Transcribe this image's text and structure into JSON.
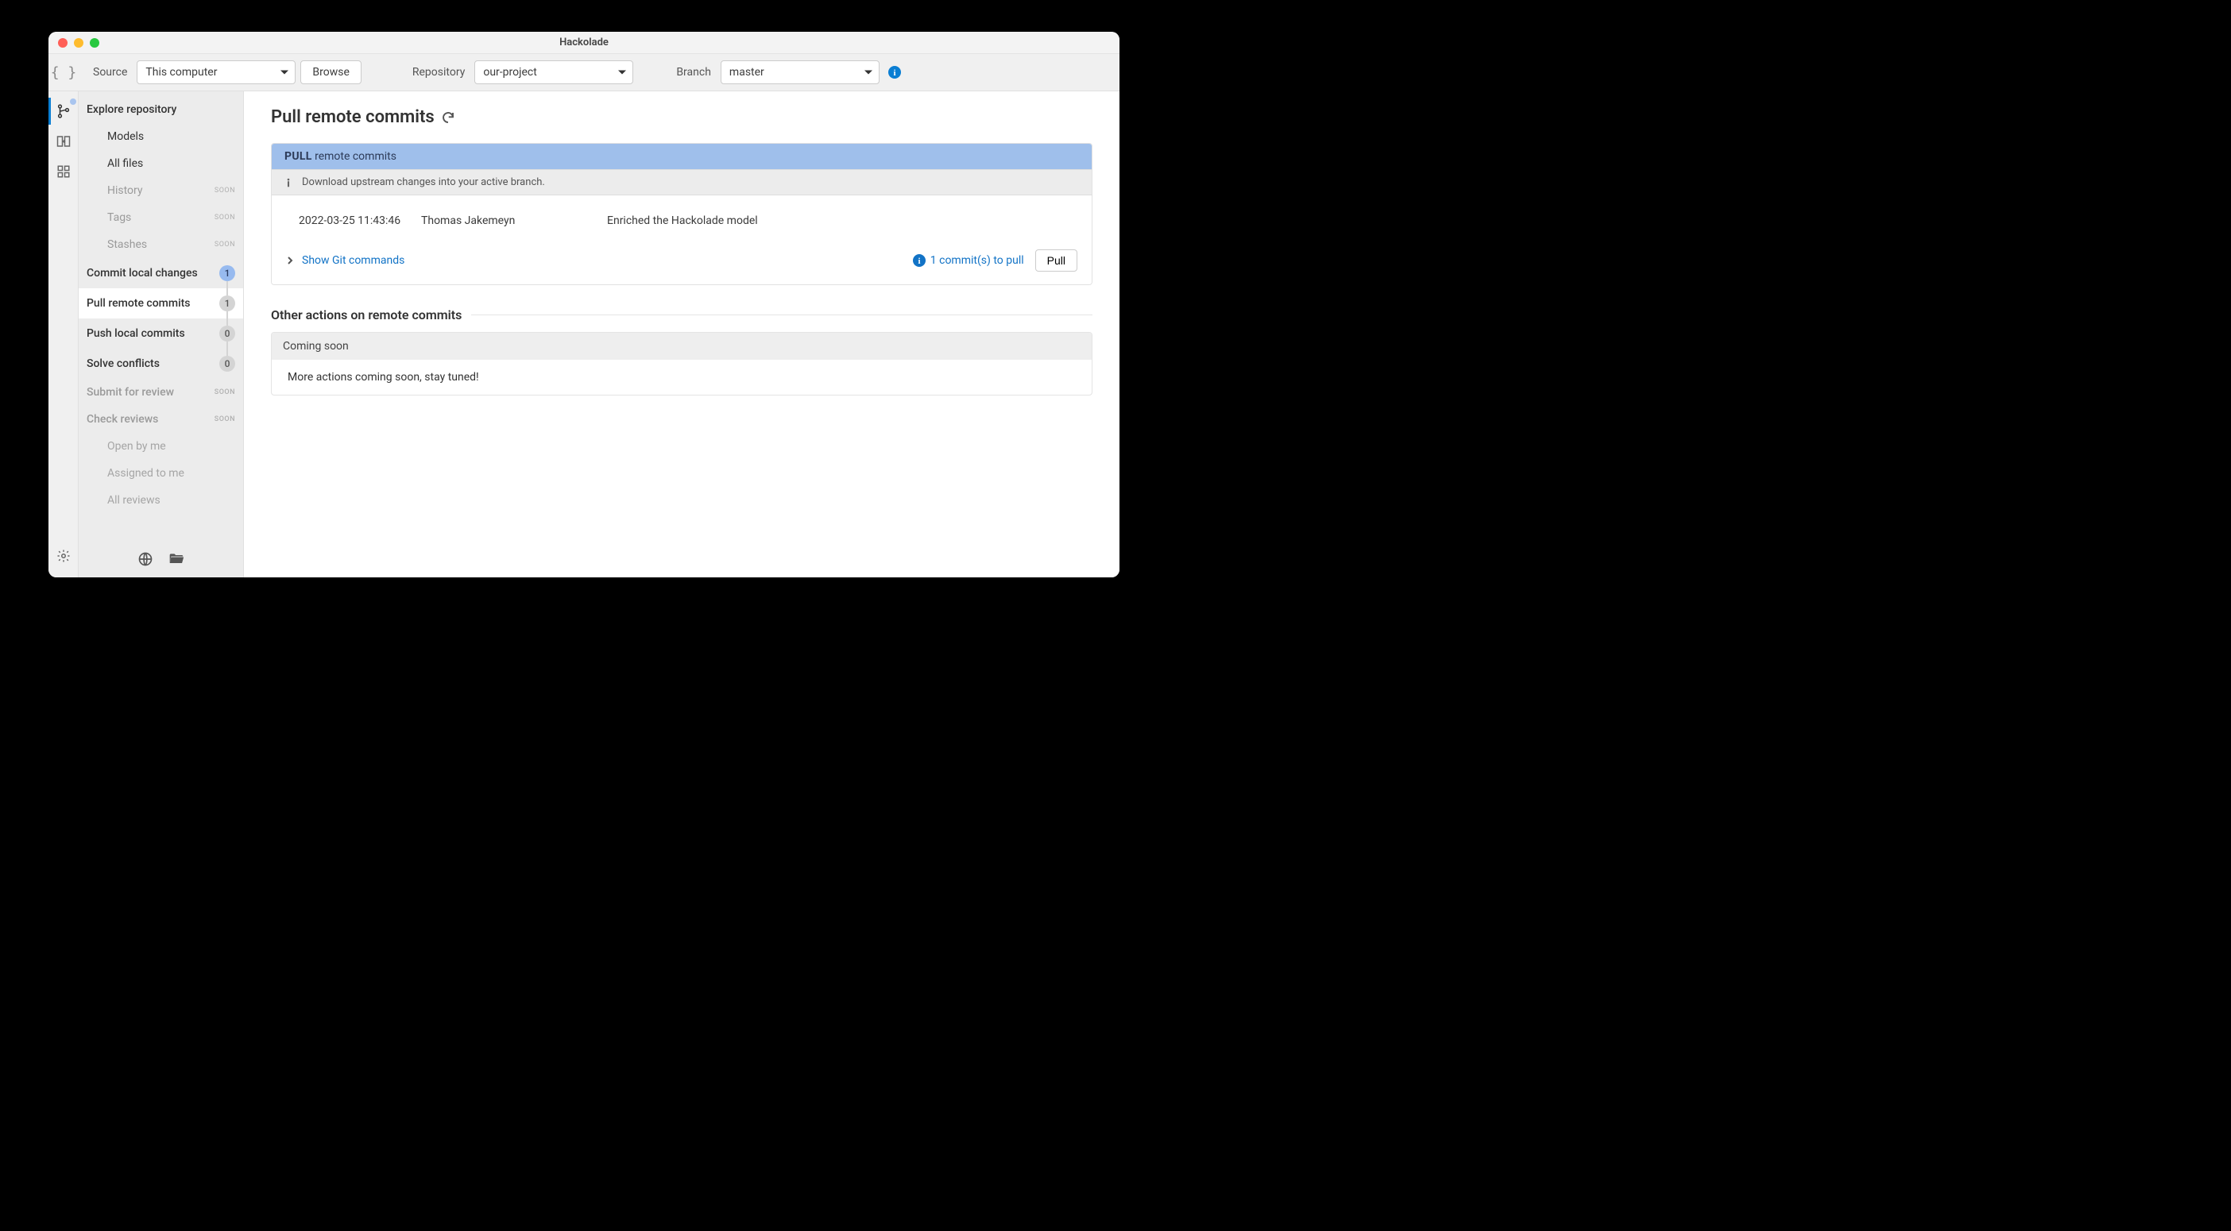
{
  "window": {
    "title": "Hackolade"
  },
  "toolbar": {
    "source_label": "Source",
    "source_value": "This computer",
    "browse_label": "Browse",
    "repo_label": "Repository",
    "repo_value": "our-project",
    "branch_label": "Branch",
    "branch_value": "master"
  },
  "sidebar": {
    "explore_label": "Explore repository",
    "explore": {
      "models": "Models",
      "all_files": "All files",
      "history": "History",
      "tags": "Tags",
      "stashes": "Stashes"
    },
    "commit_local": {
      "label": "Commit local changes",
      "count": "1"
    },
    "pull_remote": {
      "label": "Pull remote commits",
      "count": "1"
    },
    "push_local": {
      "label": "Push local commits",
      "count": "0"
    },
    "solve_conflicts": {
      "label": "Solve conflicts",
      "count": "0"
    },
    "submit_review": "Submit for review",
    "check_reviews": "Check reviews",
    "reviews": {
      "open_by_me": "Open by me",
      "assigned": "Assigned to me",
      "all": "All reviews"
    },
    "soon": "SOON"
  },
  "main": {
    "title": "Pull remote commits",
    "panel_header_verb": "PULL",
    "panel_header_rest": "  remote commits",
    "panel_info": "Download upstream changes into your active branch.",
    "commit": {
      "date": "2022-03-25 11:43:46",
      "author": "Thomas Jakemeyn",
      "message": "Enriched the Hackolade model"
    },
    "show_git": "Show Git commands",
    "pull_info": "1 commit(s) to pull",
    "pull_button": "Pull",
    "other_actions_title": "Other actions on remote commits",
    "coming_soon_title": "Coming soon",
    "coming_soon_body": "More actions coming soon, stay tuned!"
  }
}
